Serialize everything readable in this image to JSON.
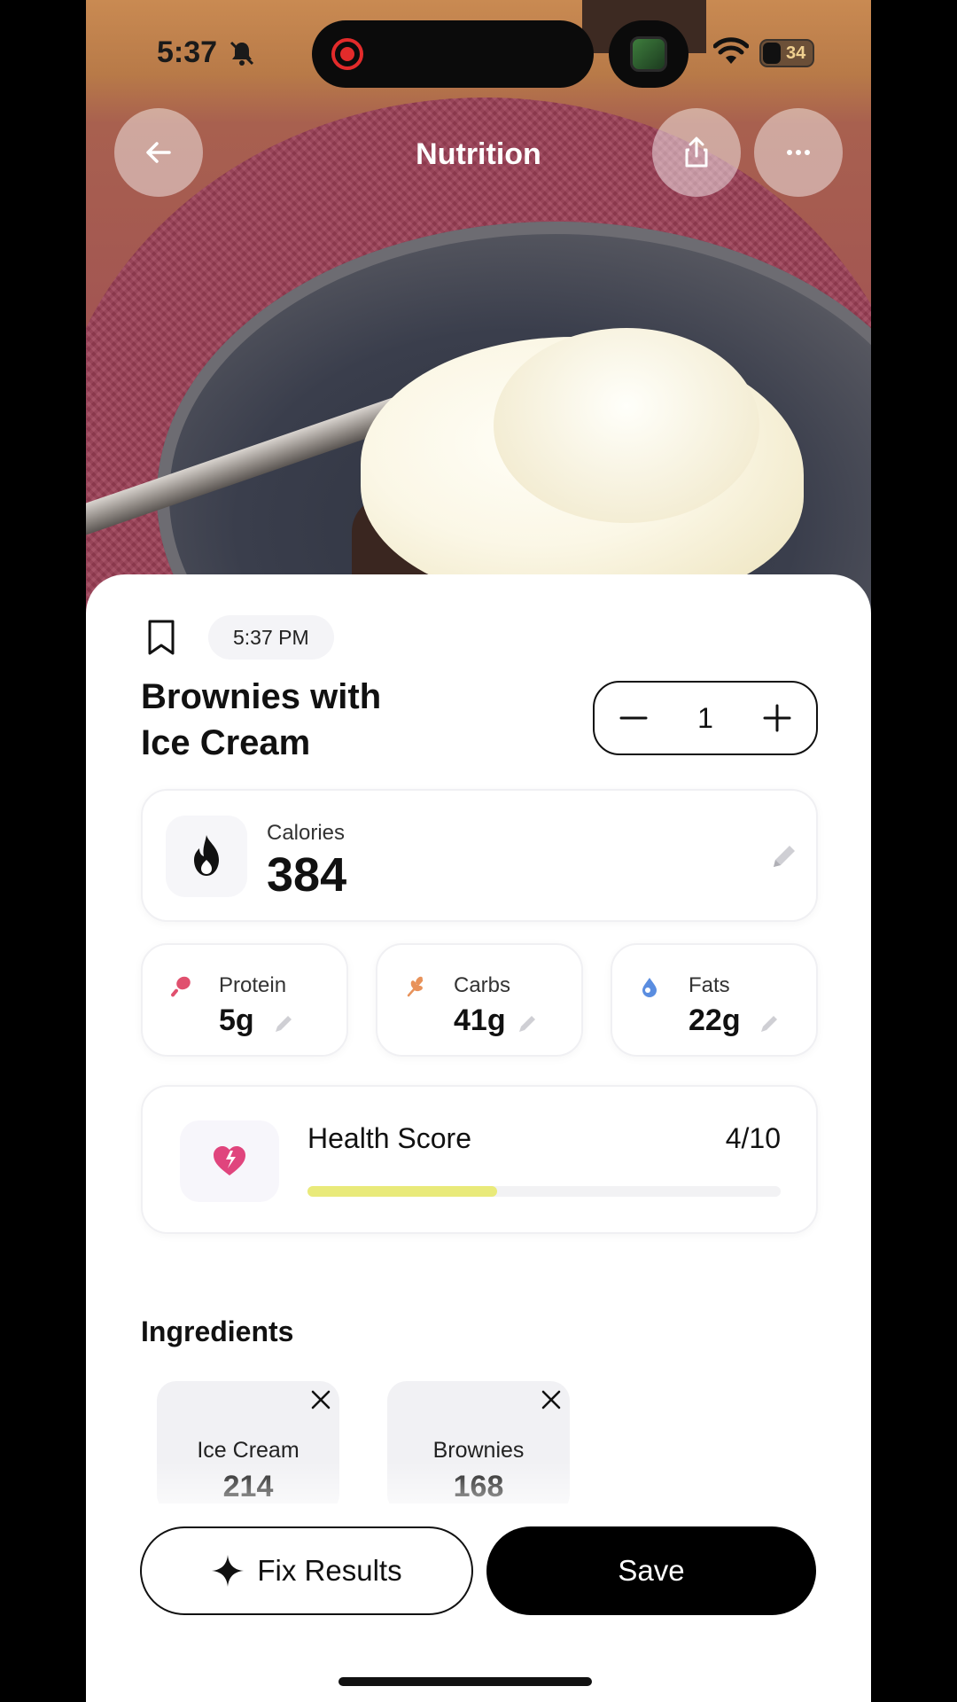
{
  "status_bar": {
    "time": "5:37",
    "battery": "34"
  },
  "header": {
    "title": "Nutrition",
    "icons": [
      "back-arrow-icon",
      "share-icon",
      "more-icon"
    ]
  },
  "entry": {
    "time": "5:37 PM",
    "title_line1": "Brownies with",
    "title_line2": "Ice Cream",
    "quantity": "1"
  },
  "calories": {
    "label": "Calories",
    "value": "384"
  },
  "macros": [
    {
      "label": "Protein",
      "value": "5g",
      "color": "#e0506e",
      "icon": "drumstick-icon"
    },
    {
      "label": "Carbs",
      "value": "41g",
      "color": "#e8925a",
      "icon": "wheat-icon"
    },
    {
      "label": "Fats",
      "value": "22g",
      "color": "#5a8de0",
      "icon": "droplet-icon"
    }
  ],
  "health": {
    "label": "Health Score",
    "score": "4/10",
    "fraction": 0.4,
    "icon_color": "#e0457d"
  },
  "ingredients": {
    "title": "Ingredients",
    "items": [
      {
        "name": "Ice Cream",
        "value": "214"
      },
      {
        "name": "Brownies",
        "value": "168"
      }
    ]
  },
  "actions": {
    "fix_label": "Fix Results",
    "save_label": "Save"
  }
}
